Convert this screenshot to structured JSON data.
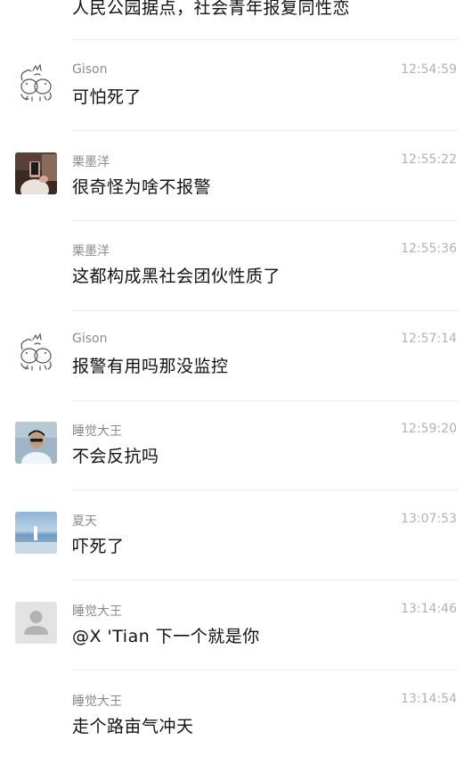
{
  "top_message": "人民公园据点，社会青年报复同性恋",
  "messages": [
    {
      "name": "Gison",
      "time": "12:54:59",
      "text": "可怕死了",
      "avatar": "cartoon-cats-icon"
    },
    {
      "name": "栗墨洋",
      "time": "12:55:22",
      "text": "很奇怪为啥不报警",
      "avatar": "selfie-photo"
    },
    {
      "name": "栗墨洋",
      "time": "12:55:36",
      "text": "这都构成黑社会团伙性质了",
      "avatar": ""
    },
    {
      "name": "Gison",
      "time": "12:57:14",
      "text": "报警有用吗那没监控",
      "avatar": "cartoon-cats-icon"
    },
    {
      "name": "睡觉大王",
      "time": "12:59:20",
      "text": "不会反抗吗",
      "avatar": "man-sunglasses-photo"
    },
    {
      "name": "夏天",
      "time": "13:07:53",
      "text": "吓死了",
      "avatar": "beach-photo"
    },
    {
      "name": "睡觉大王",
      "time": "13:14:46",
      "text": "@X 'Tian 下一个就是你",
      "avatar": "default-user-icon"
    },
    {
      "name": "睡觉大王",
      "time": "13:14:54",
      "text": "走个路亩气冲天",
      "avatar": ""
    }
  ]
}
